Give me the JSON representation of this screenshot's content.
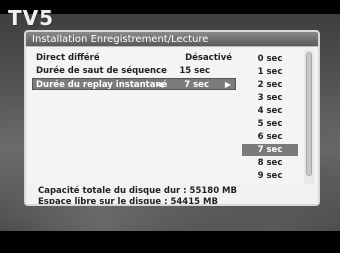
{
  "channel": {
    "logo": "TV5"
  },
  "dialog": {
    "title": "Installation Enregistrement/Lecture",
    "settings": [
      {
        "label": "Direct différé",
        "value": "Désactivé"
      },
      {
        "label": "Durée de saut de séquence",
        "value": "15 sec"
      },
      {
        "label": "Durée du replay instantané",
        "value": "7 sec",
        "left_arrow": "◀",
        "right_arrow": "▶"
      }
    ],
    "options": [
      "0 sec",
      "1 sec",
      "2 sec",
      "3 sec",
      "4 sec",
      "5 sec",
      "6 sec",
      "7 sec",
      "8 sec",
      "9 sec"
    ],
    "selected_option": "7 sec",
    "disk": {
      "total": "Capacité totale du disque dur : 55180 MB",
      "free": "Espace libre sur le disque : 54415 MB"
    }
  }
}
